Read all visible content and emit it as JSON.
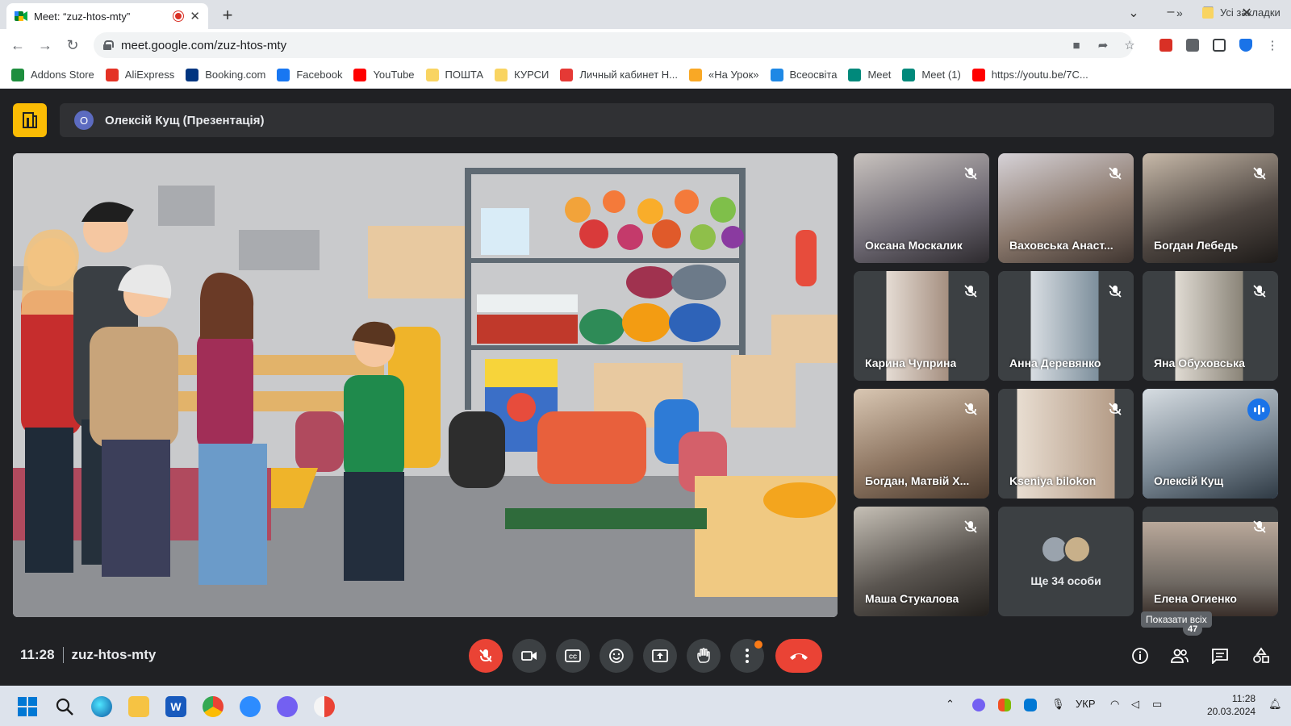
{
  "browser": {
    "tab_title": "Meet: “zuz-htos-mty”",
    "url": "meet.google.com/zuz-htos-mty",
    "new_tab": "+",
    "close_tab": "✕"
  },
  "bookmarks": [
    {
      "label": "Addons Store",
      "icon": "addons-store-icon",
      "color": "#1e8e3e"
    },
    {
      "label": "AliExpress",
      "icon": "aliexpress-icon",
      "color": "#e43225"
    },
    {
      "label": "Booking.com",
      "icon": "booking-icon",
      "color": "#003580"
    },
    {
      "label": "Facebook",
      "icon": "facebook-icon",
      "color": "#1877f2"
    },
    {
      "label": "YouTube",
      "icon": "youtube-icon",
      "color": "#ff0000"
    },
    {
      "label": "ПОШТА",
      "icon": "folder-icon",
      "color": "#f9d461"
    },
    {
      "label": "КУРСИ",
      "icon": "folder-icon",
      "color": "#f9d461"
    },
    {
      "label": "Личный кабинет Н...",
      "icon": "cabinet-icon",
      "color": "#e53935"
    },
    {
      "label": "«На Урок»",
      "icon": "bell-icon",
      "color": "#f9a825"
    },
    {
      "label": "Всеосвіта",
      "icon": "snowflake-icon",
      "color": "#1e88e5"
    },
    {
      "label": "Meet",
      "icon": "meet-icon",
      "color": "#00897b"
    },
    {
      "label": "Meet (1)",
      "icon": "meet-icon",
      "color": "#00897b"
    },
    {
      "label": "https://youtu.be/7C...",
      "icon": "youtube-icon",
      "color": "#ff0000"
    }
  ],
  "bookmarks_more": "»",
  "all_bookmarks": "Усі закладки",
  "presentation": {
    "avatar_letter": "О",
    "title": "Олексій Кущ (Презентація)"
  },
  "participants": [
    {
      "name": "Оксана Москалик",
      "muted": true,
      "bg": "#6b6670"
    },
    {
      "name": "Ваховська Анаст...",
      "muted": true,
      "bg": "#8c7a6e"
    },
    {
      "name": "Богдан Лебедь",
      "muted": true,
      "bg": "#4d4540"
    },
    {
      "name": "Карина Чуприна",
      "muted": true,
      "bg": "#a58f80"
    },
    {
      "name": "Анна Деревянко",
      "muted": true,
      "bg": "#7d8f9c"
    },
    {
      "name": "Яна Обуховська",
      "muted": true,
      "bg": "#8a8478"
    },
    {
      "name": "Богдан, Матвій Х...",
      "muted": true,
      "bg": "#8e7662"
    },
    {
      "name": "Kseniya bilokon",
      "muted": true,
      "bg": "#b59d88"
    },
    {
      "name": "Олексій Кущ",
      "muted": false,
      "speaking": true,
      "bg": "#7c8a96"
    },
    {
      "name": "Маша Стукалова",
      "muted": true,
      "bg": "#5a5550"
    }
  ],
  "others_tile": {
    "label": "Ще 34 особи"
  },
  "last_tile": {
    "name": "Елена Огиенко",
    "muted": true,
    "bg": "#6e6862"
  },
  "tooltip": "Показати всіх",
  "people_count": "47",
  "meeting": {
    "time": "11:28",
    "code": "zuz-htos-mty"
  },
  "taskbar": {
    "lang": "УКР",
    "time": "11:28",
    "date": "20.03.2024"
  }
}
